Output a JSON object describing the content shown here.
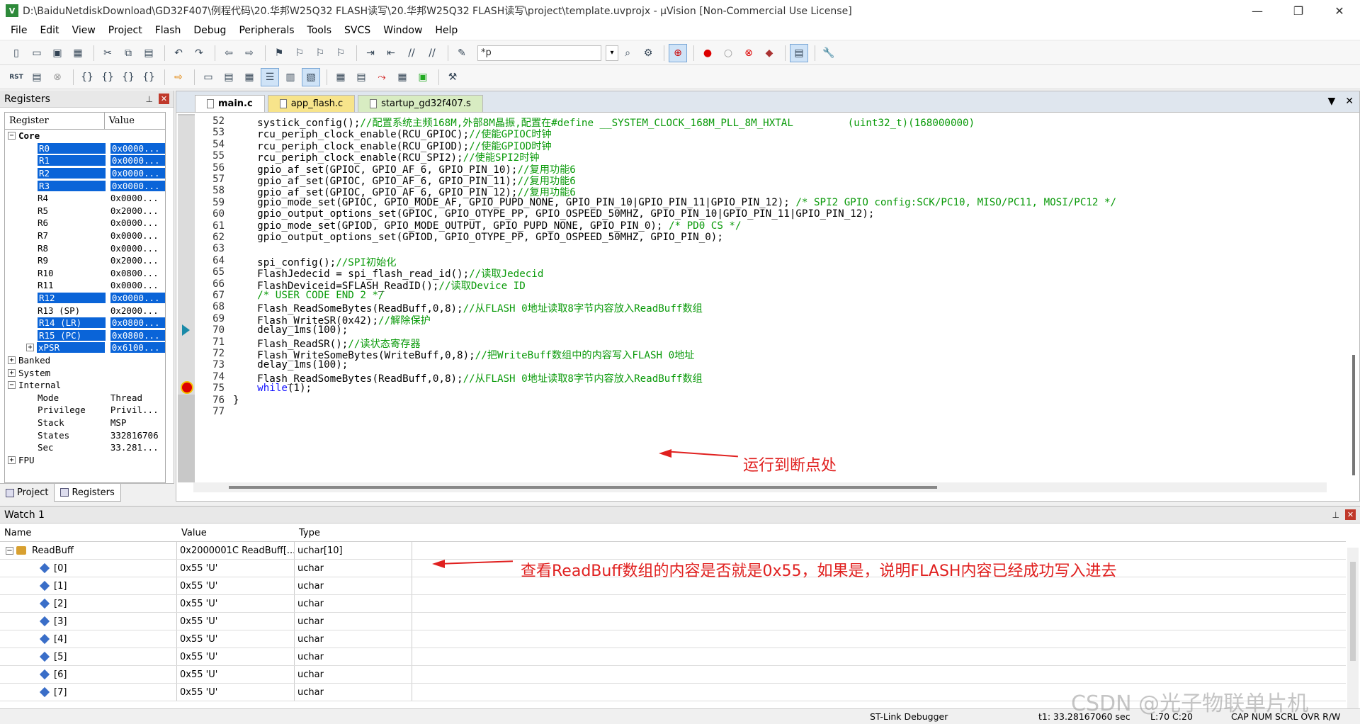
{
  "window": {
    "title": "D:\\BaiduNetdiskDownload\\GD32F407\\例程代码\\20.华邦W25Q32 FLASH读写\\20.华邦W25Q32 FLASH读写\\project\\template.uvprojx - µVision  [Non-Commercial Use License]",
    "icon_text": "V"
  },
  "menu": [
    "File",
    "Edit",
    "View",
    "Project",
    "Flash",
    "Debug",
    "Peripherals",
    "Tools",
    "SVCS",
    "Window",
    "Help"
  ],
  "toolbar": {
    "find_value": "*p"
  },
  "registers": {
    "title": "Registers",
    "col_register": "Register",
    "col_value": "Value",
    "rows": [
      {
        "name": "Core",
        "value": "",
        "level": 0,
        "expand": "−",
        "bold": true,
        "sel": false
      },
      {
        "name": "R0",
        "value": "0x0000...",
        "level": 2,
        "expand": "",
        "sel": true
      },
      {
        "name": "R1",
        "value": "0x0000...",
        "level": 2,
        "expand": "",
        "sel": true
      },
      {
        "name": "R2",
        "value": "0x0000...",
        "level": 2,
        "expand": "",
        "sel": true
      },
      {
        "name": "R3",
        "value": "0x0000...",
        "level": 2,
        "expand": "",
        "sel": true
      },
      {
        "name": "R4",
        "value": "0x0000...",
        "level": 2,
        "expand": "",
        "sel": false
      },
      {
        "name": "R5",
        "value": "0x2000...",
        "level": 2,
        "expand": "",
        "sel": false
      },
      {
        "name": "R6",
        "value": "0x0000...",
        "level": 2,
        "expand": "",
        "sel": false
      },
      {
        "name": "R7",
        "value": "0x0000...",
        "level": 2,
        "expand": "",
        "sel": false
      },
      {
        "name": "R8",
        "value": "0x0000...",
        "level": 2,
        "expand": "",
        "sel": false
      },
      {
        "name": "R9",
        "value": "0x2000...",
        "level": 2,
        "expand": "",
        "sel": false
      },
      {
        "name": "R10",
        "value": "0x0800...",
        "level": 2,
        "expand": "",
        "sel": false
      },
      {
        "name": "R11",
        "value": "0x0000...",
        "level": 2,
        "expand": "",
        "sel": false
      },
      {
        "name": "R12",
        "value": "0x0000...",
        "level": 2,
        "expand": "",
        "sel": true
      },
      {
        "name": "R13 (SP)",
        "value": "0x2000...",
        "level": 2,
        "expand": "",
        "sel": false
      },
      {
        "name": "R14 (LR)",
        "value": "0x0800...",
        "level": 2,
        "expand": "",
        "sel": true
      },
      {
        "name": "R15 (PC)",
        "value": "0x0800...",
        "level": 2,
        "expand": "",
        "sel": true
      },
      {
        "name": "xPSR",
        "value": "0x6100...",
        "level": 1,
        "expand": "+",
        "sel": true
      },
      {
        "name": "Banked",
        "value": "",
        "level": 0,
        "expand": "+",
        "sel": false
      },
      {
        "name": "System",
        "value": "",
        "level": 0,
        "expand": "+",
        "sel": false
      },
      {
        "name": "Internal",
        "value": "",
        "level": 0,
        "expand": "−",
        "sel": false
      },
      {
        "name": "Mode",
        "value": "Thread",
        "level": 2,
        "expand": "",
        "sel": false
      },
      {
        "name": "Privilege",
        "value": "Privil...",
        "level": 2,
        "expand": "",
        "sel": false
      },
      {
        "name": "Stack",
        "value": "MSP",
        "level": 2,
        "expand": "",
        "sel": false
      },
      {
        "name": "States",
        "value": "332816706",
        "level": 2,
        "expand": "",
        "sel": false
      },
      {
        "name": "Sec",
        "value": "33.281...",
        "level": 2,
        "expand": "",
        "sel": false
      },
      {
        "name": "FPU",
        "value": "",
        "level": 0,
        "expand": "+",
        "sel": false
      }
    ],
    "tab_project": "Project",
    "tab_registers": "Registers"
  },
  "editor": {
    "tabs": [
      "main.c",
      "app_flash.c",
      "startup_gd32f407.s"
    ],
    "lines": [
      {
        "n": "52",
        "code": "    systick_config();",
        "cm": "//配置系统主频168M,外部8M晶振,配置在#define __SYSTEM_CLOCK_168M_PLL_8M_HXTAL         (uint32_t)(168000000)"
      },
      {
        "n": "53",
        "code": "    rcu_periph_clock_enable(RCU_GPIOC);",
        "cm": "//使能GPIOC时钟"
      },
      {
        "n": "54",
        "code": "    rcu_periph_clock_enable(RCU_GPIOD);",
        "cm": "//使能GPIOD时钟"
      },
      {
        "n": "55",
        "code": "    rcu_periph_clock_enable(RCU_SPI2);",
        "cm": "//使能SPI2时钟"
      },
      {
        "n": "56",
        "code": "    gpio_af_set(GPIOC, GPIO_AF_6, GPIO_PIN_10);",
        "cm": "//复用功能6"
      },
      {
        "n": "57",
        "code": "    gpio_af_set(GPIOC, GPIO_AF_6, GPIO_PIN_11);",
        "cm": "//复用功能6"
      },
      {
        "n": "58",
        "code": "    gpio_af_set(GPIOC, GPIO_AF_6, GPIO_PIN_12);",
        "cm": "//复用功能6"
      },
      {
        "n": "59",
        "code": "    gpio_mode_set(GPIOC, GPIO_MODE_AF, GPIO_PUPD_NONE, GPIO_PIN_10|GPIO_PIN_11|GPIO_PIN_12); ",
        "cm": "/* SPI2 GPIO config:SCK/PC10, MISO/PC11, MOSI/PC12 */"
      },
      {
        "n": "60",
        "code": "    gpio_output_options_set(GPIOC, GPIO_OTYPE_PP, GPIO_OSPEED_50MHZ, GPIO_PIN_10|GPIO_PIN_11|GPIO_PIN_12);",
        "cm": ""
      },
      {
        "n": "61",
        "code": "    gpio_mode_set(GPIOD, GPIO_MODE_OUTPUT, GPIO_PUPD_NONE, GPIO_PIN_0); ",
        "cm": "/* PD0 CS */"
      },
      {
        "n": "62",
        "code": "    gpio_output_options_set(GPIOD, GPIO_OTYPE_PP, GPIO_OSPEED_50MHZ, GPIO_PIN_0);",
        "cm": ""
      },
      {
        "n": "63",
        "code": "",
        "cm": ""
      },
      {
        "n": "64",
        "code": "    spi_config();",
        "cm": "//SPI初始化"
      },
      {
        "n": "65",
        "code": "    FlashJedecid = spi_flash_read_id();",
        "cm": "//读取Jedecid"
      },
      {
        "n": "66",
        "code": "    FlashDeviceid=SFLASH_ReadID();",
        "cm": "//读取Device ID"
      },
      {
        "n": "67",
        "code": "    ",
        "cm": "/* USER CODE END 2 */"
      },
      {
        "n": "68",
        "code": "    Flash_ReadSomeBytes(ReadBuff,0,8);",
        "cm": "//从FLASH 0地址读取8字节内容放入ReadBuff数组"
      },
      {
        "n": "69",
        "code": "    Flash_WriteSR(0x42);",
        "cm": "//解除保护"
      },
      {
        "n": "70",
        "code": "    delay_1ms(100);",
        "cm": ""
      },
      {
        "n": "71",
        "code": "    Flash_ReadSR();",
        "cm": "//读状态寄存器"
      },
      {
        "n": "72",
        "code": "    Flash_WriteSomeBytes(WriteBuff,0,8);",
        "cm": "//把WriteBuff数组中的内容写入FLASH 0地址"
      },
      {
        "n": "73",
        "code": "    delay_1ms(100);",
        "cm": ""
      },
      {
        "n": "74",
        "code": "    Flash_ReadSomeBytes(ReadBuff,0,8);",
        "cm": "//从FLASH 0地址读取8字节内容放入ReadBuff数组"
      },
      {
        "n": "75",
        "code": "    ",
        "kw": "while",
        "rest": "(1);",
        "cm": ""
      },
      {
        "n": "76",
        "code": "}",
        "cm": ""
      },
      {
        "n": "77",
        "code": "",
        "cm": ""
      }
    ],
    "annotation": "运行到断点处"
  },
  "watch": {
    "title": "Watch 1",
    "col_name": "Name",
    "col_value": "Value",
    "col_type": "Type",
    "rows": [
      {
        "name": "ReadBuff",
        "value": "0x2000001C ReadBuff[...",
        "type": "uchar[10]",
        "root": true
      },
      {
        "name": "[0]",
        "value": "0x55 'U'",
        "type": "uchar"
      },
      {
        "name": "[1]",
        "value": "0x55 'U'",
        "type": "uchar"
      },
      {
        "name": "[2]",
        "value": "0x55 'U'",
        "type": "uchar"
      },
      {
        "name": "[3]",
        "value": "0x55 'U'",
        "type": "uchar"
      },
      {
        "name": "[4]",
        "value": "0x55 'U'",
        "type": "uchar"
      },
      {
        "name": "[5]",
        "value": "0x55 'U'",
        "type": "uchar"
      },
      {
        "name": "[6]",
        "value": "0x55 'U'",
        "type": "uchar"
      },
      {
        "name": "[7]",
        "value": "0x55 'U'",
        "type": "uchar"
      }
    ],
    "annotation": "查看ReadBuff数组的内容是否就是0x55，如果是，说明FLASH内容已经成功写入进去"
  },
  "status": {
    "debugger": "ST-Link Debugger",
    "time": "t1: 33.28167060 sec",
    "pos": "L:70 C:20",
    "flags": "CAP  NUM  SCRL  OVR  R/W"
  },
  "watermark": "CSDN @光子物联单片机"
}
